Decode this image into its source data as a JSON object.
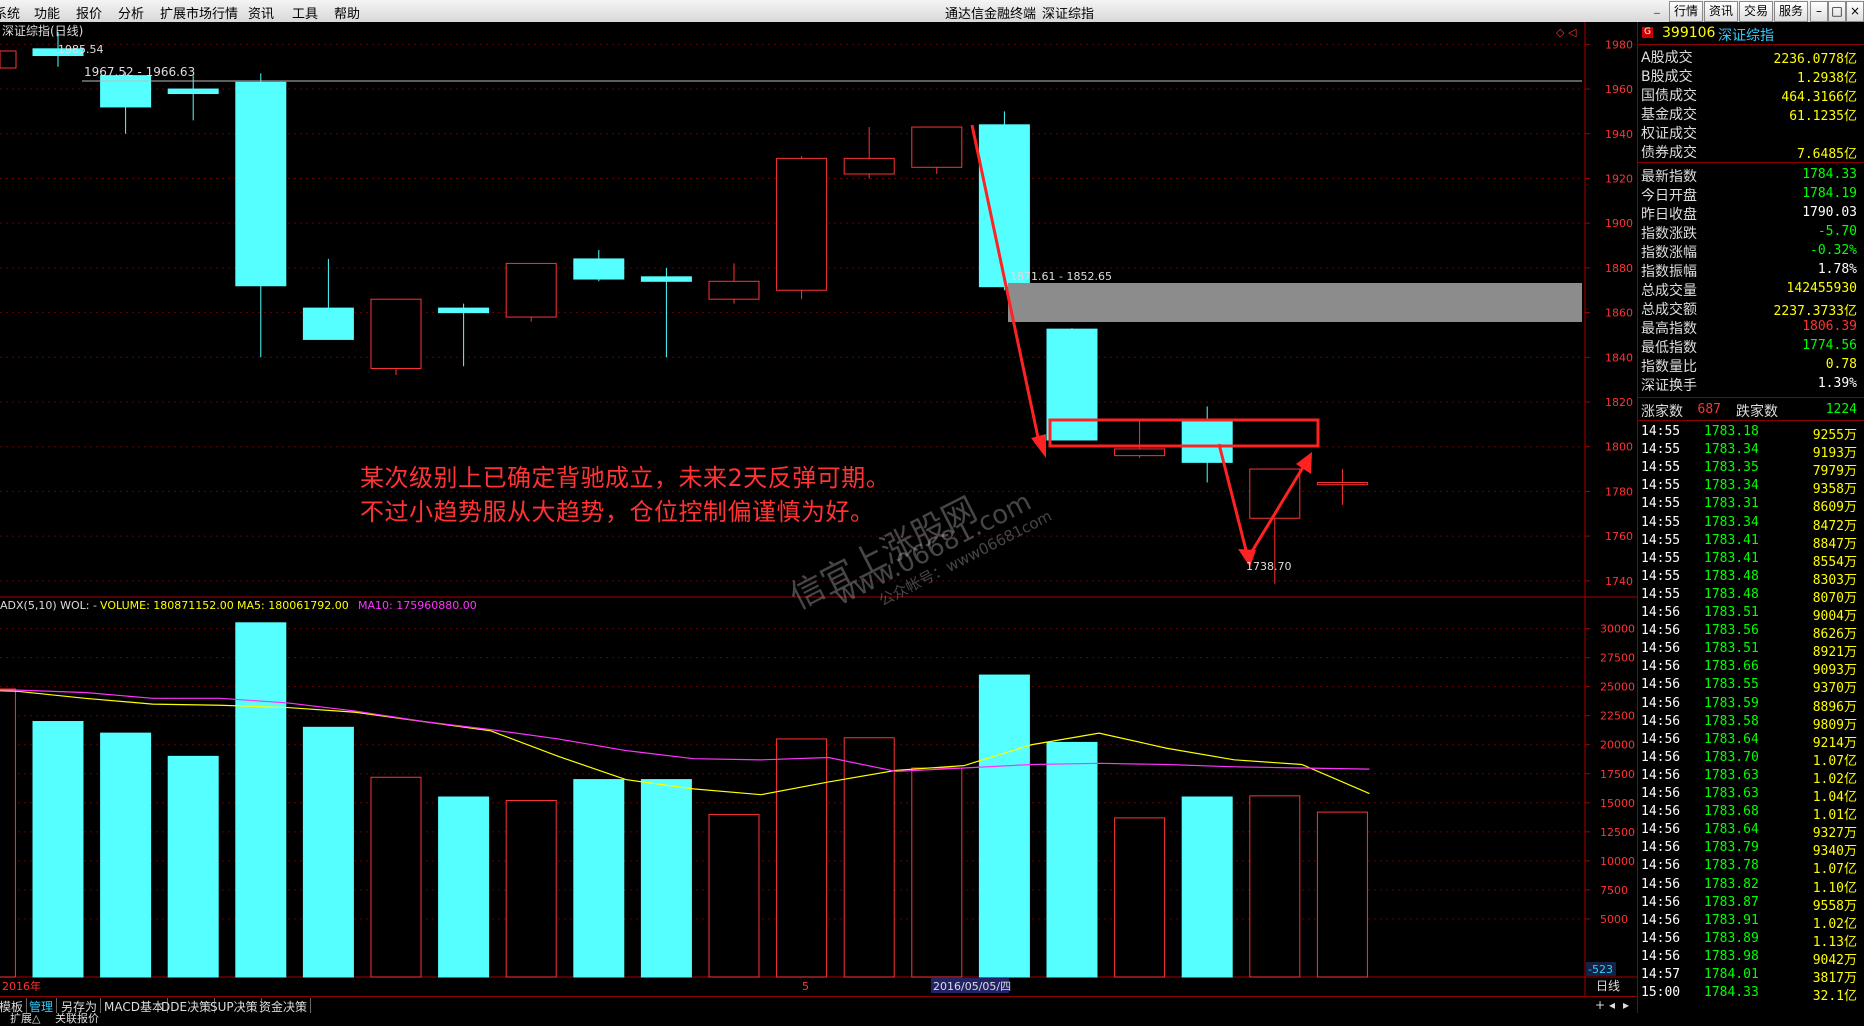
{
  "menu": {
    "items": [
      "系统",
      "功能",
      "报价",
      "分析",
      "扩展市场行情",
      "资讯",
      "工具",
      "帮助"
    ],
    "center_title": "通达信金融终端",
    "center_name": "深证综指",
    "right_buttons": [
      "行情",
      "资讯",
      "交易",
      "服务"
    ]
  },
  "chart": {
    "title": "深证综指(日线)",
    "hline_label": "1967.52 - 1966.63",
    "gap_label": "1871.61 - 1852.65",
    "high_label": "1985.54",
    "low_label": "1738.70",
    "axis_labels": [
      "1980",
      "1960",
      "1940",
      "1920",
      "1900",
      "1880",
      "1860",
      "1840",
      "1820",
      "1800",
      "1780",
      "1760",
      "1740"
    ],
    "annotation_line1": "某次级别上已确定背驰成立，未来2天反弹可期。",
    "annotation_line2": "不过小趋势服从大趋势，仓位控制偏谨慎为好。",
    "watermark1": "信宜上涨股网",
    "watermark2": "www.06681.com",
    "watermark3": "公众帐号：www06681com"
  },
  "volume": {
    "label": "ADX(5,10) WOL: -",
    "volume_text": "VOLUME: 180871152.00",
    "ma5_text": "MA5: 180061792.00",
    "ma10_text": "MA10: 175960880.00",
    "axis_labels": [
      "30000",
      "27500",
      "25000",
      "22500",
      "20000",
      "17500",
      "15000",
      "12500",
      "10000",
      "7500",
      "5000"
    ],
    "bottom_value": "-523"
  },
  "chart_data": {
    "type": "candlestick",
    "ylim": [
      1735,
      1990
    ],
    "candles": [
      {
        "o": 1975,
        "h": 1985.54,
        "l": 1970,
        "c": 1978,
        "up": false
      },
      {
        "o": 1966,
        "h": 1967.5,
        "l": 1940,
        "c": 1952,
        "up": false
      },
      {
        "o": 1960,
        "h": 1966,
        "l": 1946,
        "c": 1958,
        "up": false
      },
      {
        "o": 1963,
        "h": 1967,
        "l": 1840,
        "c": 1872,
        "up": false
      },
      {
        "o": 1862,
        "h": 1884,
        "l": 1848,
        "c": 1848,
        "up": false
      },
      {
        "o": 1835,
        "h": 1866,
        "l": 1832,
        "c": 1866,
        "up": true
      },
      {
        "o": 1860,
        "h": 1864,
        "l": 1836,
        "c": 1862,
        "up": false
      },
      {
        "o": 1858,
        "h": 1882,
        "l": 1856,
        "c": 1882,
        "up": true
      },
      {
        "o": 1884,
        "h": 1888,
        "l": 1874,
        "c": 1875,
        "up": false
      },
      {
        "o": 1876,
        "h": 1880,
        "l": 1840,
        "c": 1874,
        "up": false
      },
      {
        "o": 1866,
        "h": 1882,
        "l": 1864,
        "c": 1874,
        "up": true
      },
      {
        "o": 1870,
        "h": 1930,
        "l": 1866,
        "c": 1929,
        "up": true
      },
      {
        "o": 1922,
        "h": 1943,
        "l": 1920,
        "c": 1929,
        "up": true
      },
      {
        "o": 1925,
        "h": 1943,
        "l": 1922,
        "c": 1943,
        "up": true
      },
      {
        "o": 1944,
        "h": 1950,
        "l": 1870,
        "c": 1871.6,
        "up": false
      },
      {
        "o": 1852.6,
        "h": 1853,
        "l": 1803,
        "c": 1803,
        "up": false
      },
      {
        "o": 1796,
        "h": 1812,
        "l": 1795,
        "c": 1799,
        "up": true
      },
      {
        "o": 1812,
        "h": 1818,
        "l": 1784,
        "c": 1793,
        "up": false
      },
      {
        "o": 1768,
        "h": 1790,
        "l": 1738.7,
        "c": 1790,
        "up": true
      },
      {
        "o": 1783,
        "h": 1790,
        "l": 1774,
        "c": 1784,
        "up": true
      }
    ],
    "volumes": [
      24800,
      22000,
      21000,
      19000,
      30500,
      21500,
      17200,
      15500,
      15200,
      17000,
      17000,
      14000,
      20500,
      20600,
      18000,
      26000,
      20200,
      13700,
      15500,
      15600,
      14200
    ],
    "vol_up": [
      true,
      false,
      false,
      false,
      false,
      false,
      true,
      false,
      true,
      false,
      false,
      true,
      true,
      true,
      true,
      false,
      false,
      true,
      false,
      true,
      true
    ],
    "ma5": [
      24800,
      24600,
      24000,
      23500,
      23400,
      23200,
      22800,
      22000,
      21200,
      19000,
      17000,
      16200,
      15700,
      16800,
      17800,
      18200,
      20000,
      21000,
      19700,
      18700,
      18300,
      15800
    ],
    "ma10": [
      24800,
      24700,
      24500,
      24000,
      24000,
      23600,
      22900,
      22000,
      21300,
      20500,
      19500,
      18800,
      18700,
      18900,
      17700,
      18000,
      18300,
      18400,
      18300,
      18100,
      18000,
      17900
    ]
  },
  "panel": {
    "code": "399106",
    "name": "深证综指",
    "stats": [
      {
        "label": "A股成交",
        "value": "2236.0778亿",
        "color": "y"
      },
      {
        "label": "B股成交",
        "value": "1.2938亿",
        "color": "y"
      },
      {
        "label": "国债成交",
        "value": "464.3166亿",
        "color": "y"
      },
      {
        "label": "基金成交",
        "value": "61.1235亿",
        "color": "y"
      },
      {
        "label": "权证成交",
        "value": "",
        "color": "y"
      },
      {
        "label": "债券成交",
        "value": "7.6485亿",
        "color": "y"
      }
    ],
    "index_stats": [
      {
        "label": "最新指数",
        "value": "1784.33",
        "color": "g"
      },
      {
        "label": "今日开盘",
        "value": "1784.19",
        "color": "g"
      },
      {
        "label": "昨日收盘",
        "value": "1790.03",
        "color": "w"
      },
      {
        "label": "指数涨跌",
        "value": "-5.70",
        "color": "g"
      },
      {
        "label": "指数涨幅",
        "value": "-0.32%",
        "color": "g"
      },
      {
        "label": "指数振幅",
        "value": "1.78%",
        "color": "w"
      },
      {
        "label": "总成交量",
        "value": "142455930",
        "color": "y"
      },
      {
        "label": "总成交额",
        "value": "2237.3733亿",
        "color": "y"
      },
      {
        "label": "最高指数",
        "value": "1806.39",
        "color": "r"
      },
      {
        "label": "最低指数",
        "value": "1774.56",
        "color": "g"
      },
      {
        "label": "指数量比",
        "value": "0.78",
        "color": "y"
      },
      {
        "label": "深证换手",
        "value": "1.39%",
        "color": "w"
      }
    ],
    "updown": {
      "up_label": "涨家数",
      "up_value": "687",
      "down_label": "跌家数",
      "down_value": "1224"
    },
    "ticks": [
      [
        "14:55",
        "1783.18",
        "9255万"
      ],
      [
        "14:55",
        "1783.34",
        "9193万"
      ],
      [
        "14:55",
        "1783.35",
        "7979万"
      ],
      [
        "14:55",
        "1783.34",
        "9358万"
      ],
      [
        "14:55",
        "1783.31",
        "8609万"
      ],
      [
        "14:55",
        "1783.34",
        "8472万"
      ],
      [
        "14:55",
        "1783.41",
        "8847万"
      ],
      [
        "14:55",
        "1783.41",
        "8554万"
      ],
      [
        "14:55",
        "1783.48",
        "8303万"
      ],
      [
        "14:55",
        "1783.48",
        "8070万"
      ],
      [
        "14:56",
        "1783.51",
        "9004万"
      ],
      [
        "14:56",
        "1783.56",
        "8626万"
      ],
      [
        "14:56",
        "1783.51",
        "8921万"
      ],
      [
        "14:56",
        "1783.66",
        "9093万"
      ],
      [
        "14:56",
        "1783.55",
        "9370万"
      ],
      [
        "14:56",
        "1783.59",
        "8896万"
      ],
      [
        "14:56",
        "1783.58",
        "9809万"
      ],
      [
        "14:56",
        "1783.64",
        "9214万"
      ],
      [
        "14:56",
        "1783.70",
        "1.07亿"
      ],
      [
        "14:56",
        "1783.63",
        "1.02亿"
      ],
      [
        "14:56",
        "1783.63",
        "1.04亿"
      ],
      [
        "14:56",
        "1783.68",
        "1.01亿"
      ],
      [
        "14:56",
        "1783.64",
        "9327万"
      ],
      [
        "14:56",
        "1783.79",
        "9340万"
      ],
      [
        "14:56",
        "1783.78",
        "1.07亿"
      ],
      [
        "14:56",
        "1783.82",
        "1.10亿"
      ],
      [
        "14:56",
        "1783.87",
        "9558万"
      ],
      [
        "14:56",
        "1783.91",
        "1.02亿"
      ],
      [
        "14:56",
        "1783.89",
        "1.13亿"
      ],
      [
        "14:56",
        "1783.98",
        "9042万"
      ],
      [
        "14:57",
        "1784.01",
        "3817万"
      ],
      [
        "15:00",
        "1784.33",
        "32.1亿"
      ]
    ]
  },
  "bottom": {
    "year_label": "2016年",
    "mid_label": "5",
    "date_label": "2016/05/05/四",
    "period_label": "日线",
    "tabs": [
      "模板",
      "管理",
      "另存为",
      "MACD基本",
      "DDE决策",
      "SUP决策",
      "资金决策"
    ],
    "status_items": [
      "扩展△",
      "关联报价"
    ]
  }
}
